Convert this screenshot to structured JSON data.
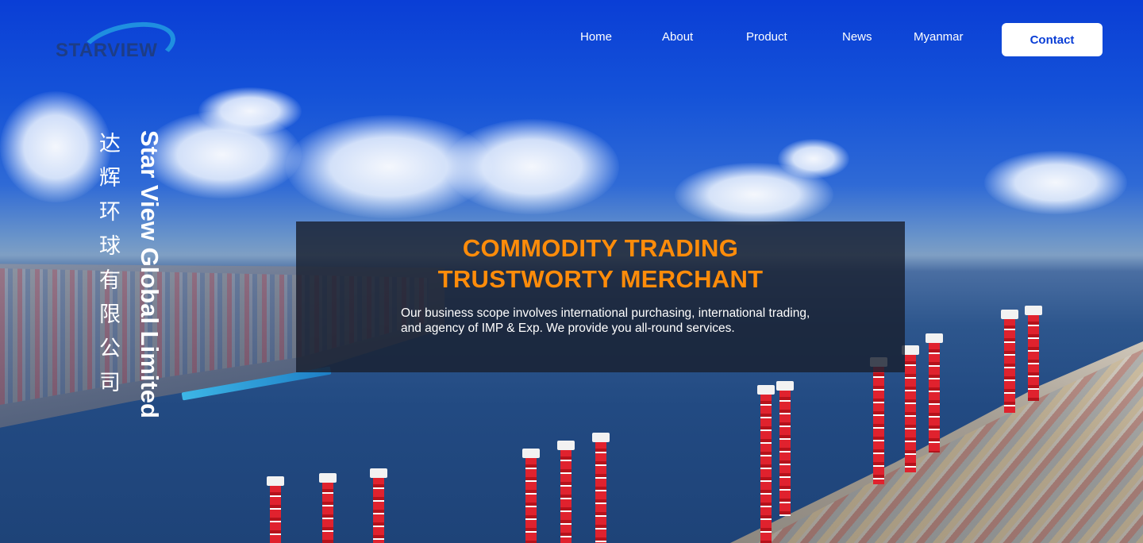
{
  "brand": {
    "logo_text": "STARVIEW"
  },
  "nav": {
    "items": [
      {
        "label": "Home"
      },
      {
        "label": "About"
      },
      {
        "label": "Product"
      },
      {
        "label": "News"
      },
      {
        "label": "Myanmar"
      }
    ],
    "contact_label": "Contact"
  },
  "hero": {
    "company_name_cn": "达辉环球有限公司",
    "company_name_en": "Star View Global Limited",
    "headline_line1": "COMMODITY TRADING",
    "headline_line2": "TRUSTWORTY MERCHANT",
    "description": "Our business scope involves international purchasing, international trading, and agency of IMP & Exp. We provide you all-round services."
  },
  "colors": {
    "accent_orange": "#ff8c0a",
    "brand_blue": "#0a3ed6",
    "logo_text_color": "#1d3d86",
    "logo_arc_color": "#1f8fe0",
    "panel_bg": "rgba(24,32,48,0.82)"
  }
}
